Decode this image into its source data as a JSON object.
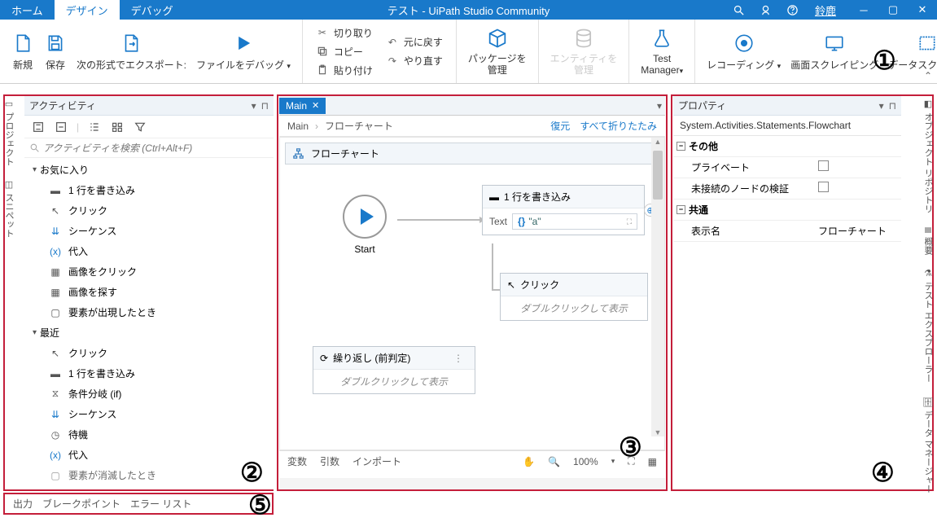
{
  "titlebar": {
    "tabs": {
      "home": "ホーム",
      "design": "デザイン",
      "debug": "デバッグ"
    },
    "title": "テスト - UiPath Studio Community",
    "user": "鈴鹿"
  },
  "ribbon": {
    "new": "新規",
    "save": "保存",
    "export": "次の形式でエクスポート:",
    "debugfile": "ファイルをデバッグ",
    "cut": "切り取り",
    "copy": "コピー",
    "paste": "貼り付け",
    "undo": "元に戻す",
    "redo": "やり直す",
    "pkgmgr_l1": "パッケージを",
    "pkgmgr_l2": "管理",
    "ent_l1": "エンティティを",
    "ent_l2": "管理",
    "testmgr_l1": "Test",
    "testmgr_l2": "Manager",
    "recording": "レコーディング",
    "screenscrape": "画面スクレイピング",
    "datascrape": "データスクレイピ"
  },
  "sideTabs": {
    "project": "プロジェクト",
    "snippets": "スニペット",
    "objrepo": "オブジェクト リポジトリ",
    "outline": "概要",
    "testexplorer": "テスト エクスプローラー",
    "datamgr": "データ マネージャー"
  },
  "activities": {
    "title": "アクティビティ",
    "searchPlaceholder": "アクティビティを検索 (Ctrl+Alt+F)",
    "groups": {
      "favorites": "お気に入り",
      "recent": "最近"
    },
    "fav": {
      "writeline": "1 行を書き込み",
      "click": "クリック",
      "sequence": "シーケンス",
      "assign": "代入",
      "imageclick": "画像をクリック",
      "findimage": "画像を探す",
      "elementappear": "要素が出現したとき"
    },
    "recent": {
      "click": "クリック",
      "writeline": "1 行を書き込み",
      "if": "条件分岐 (if)",
      "sequence": "シーケンス",
      "wait": "待機",
      "assign": "代入",
      "elemvanish": "要素が消滅したとき"
    }
  },
  "designer": {
    "tab": "Main",
    "breadcrumb": {
      "root": "Main",
      "child": "フローチャート"
    },
    "restore": "復元",
    "collapseAll": "すべて折りたたみ",
    "flowTitle": "フローチャート",
    "start": "Start",
    "writeline": {
      "title": "1 行を書き込み",
      "textLabel": "Text",
      "value": "\"a\""
    },
    "click": {
      "title": "クリック",
      "hint": "ダブルクリックして表示"
    },
    "while": {
      "title": "繰り返し (前判定)",
      "hint": "ダブルクリックして表示"
    },
    "bottomTabs": {
      "vars": "変数",
      "args": "引数",
      "imports": "インポート"
    },
    "zoom": "100%"
  },
  "props": {
    "title": "プロパティ",
    "type": "System.Activities.Statements.Flowchart",
    "cats": {
      "other": "その他",
      "common": "共通"
    },
    "rows": {
      "private": "プライベート",
      "validate": "未接続のノードの検証",
      "dispname": "表示名",
      "dispnameVal": "フローチャート"
    }
  },
  "bottom": {
    "output": "出力",
    "breakpoints": "ブレークポイント",
    "errorlist": "エラー リスト"
  },
  "circled": {
    "n1": "①",
    "n2": "②",
    "n3": "③",
    "n4": "④",
    "n5": "⑤"
  }
}
